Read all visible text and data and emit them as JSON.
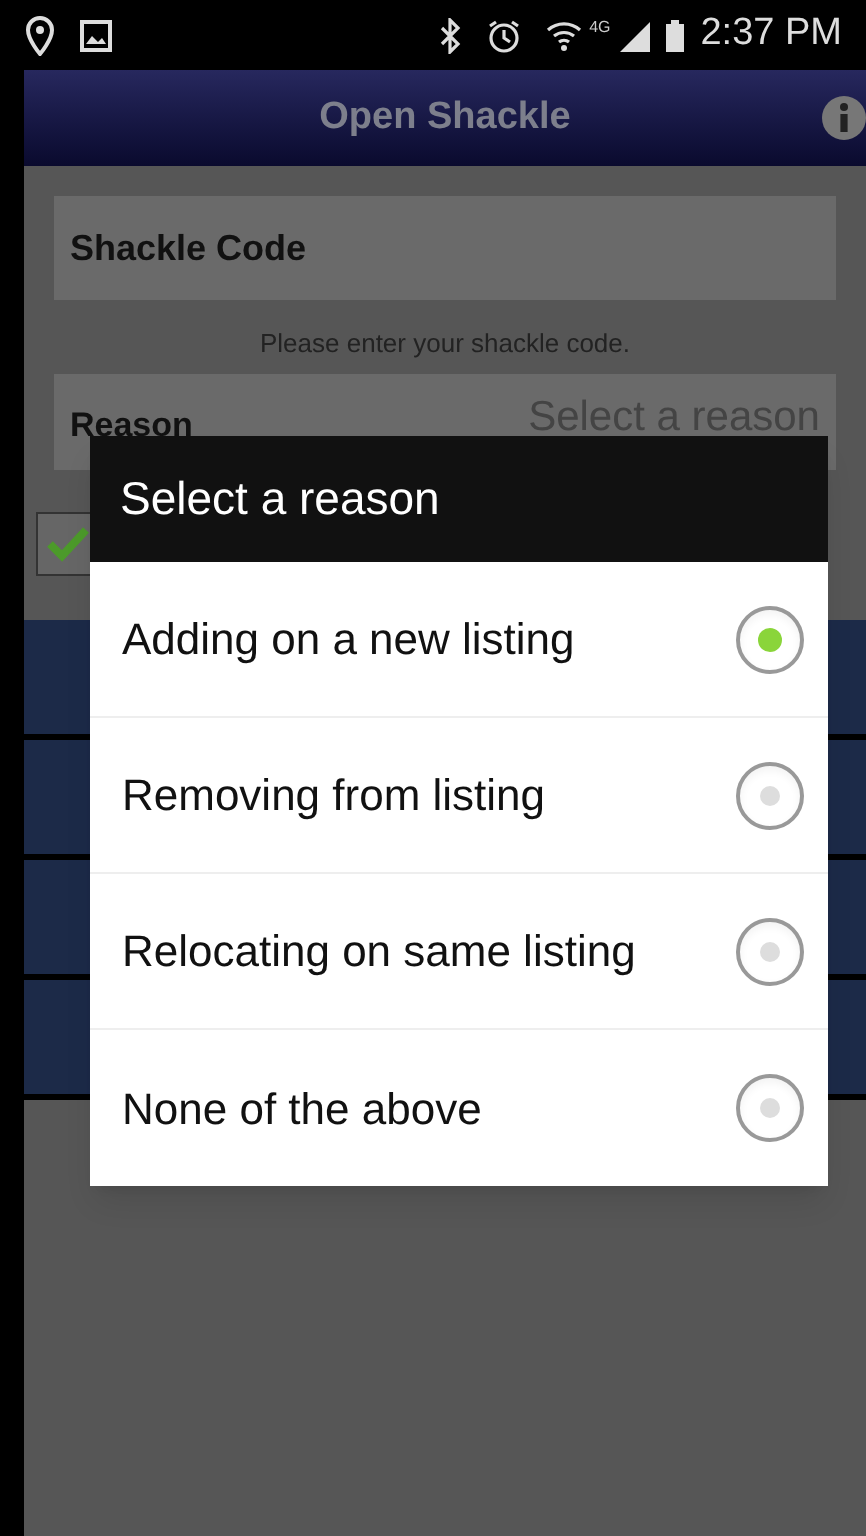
{
  "status_bar": {
    "network": "4G",
    "time": "2:37 PM"
  },
  "title_bar": {
    "title": "Open Shackle"
  },
  "form": {
    "shackle_code": {
      "placeholder": "Shackle Code"
    },
    "hint": "Please enter your shackle code.",
    "reason": {
      "label": "Reason",
      "value": "Select a reason"
    },
    "inventory_checkbox": {
      "checked": true
    }
  },
  "dialog": {
    "title": "Select a reason",
    "options": [
      {
        "label": "Adding on a new listing",
        "selected": true
      },
      {
        "label": "Removing from listing",
        "selected": false
      },
      {
        "label": "Relocating on same listing",
        "selected": false
      },
      {
        "label": "None of the above",
        "selected": false
      }
    ]
  }
}
